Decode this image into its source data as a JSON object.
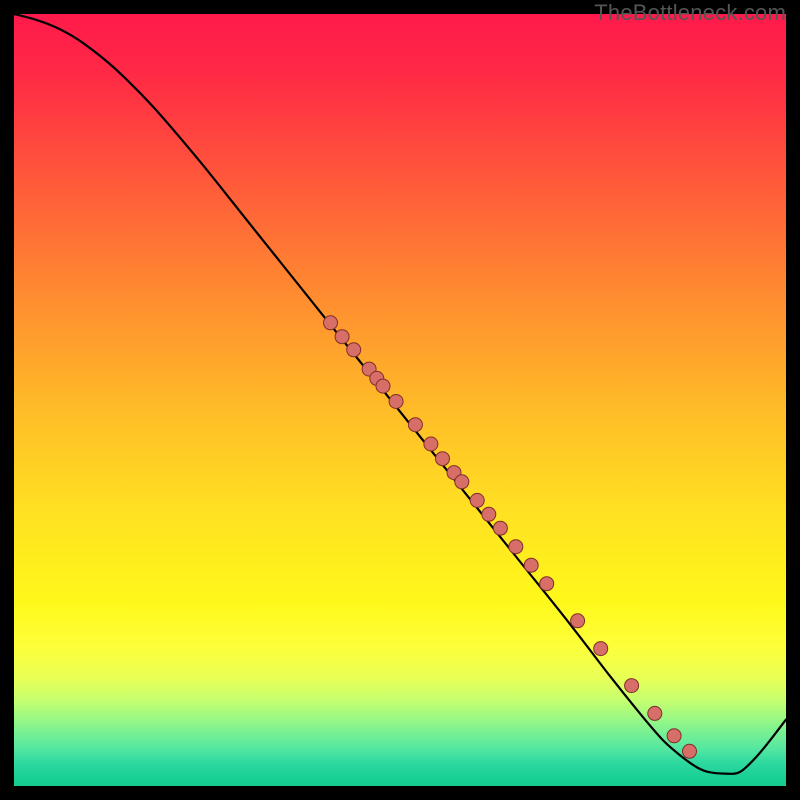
{
  "watermark": "TheBottleneck.com",
  "colors": {
    "curve": "#000000",
    "point_fill": "#d86e68",
    "point_stroke": "#7e2f2b"
  },
  "chart_data": {
    "type": "line",
    "title": "",
    "xlabel": "",
    "ylabel": "",
    "xlim": [
      0,
      100
    ],
    "ylim": [
      0,
      100
    ],
    "grid": false,
    "series": [
      {
        "name": "curve",
        "x": [
          0,
          3,
          6,
          9,
          13,
          18,
          24,
          30,
          36,
          42,
          48,
          54,
          60,
          66,
          72,
          77,
          81,
          84,
          86.5,
          88.5,
          90,
          92,
          94,
          96,
          98,
          100
        ],
        "y": [
          100,
          99.2,
          98.0,
          96.2,
          93.0,
          88.0,
          81.0,
          73.5,
          66.0,
          58.5,
          51.0,
          43.5,
          36.0,
          28.5,
          21.0,
          14.5,
          9.5,
          6.0,
          3.8,
          2.4,
          1.8,
          1.6,
          1.8,
          3.6,
          6.0,
          8.6
        ]
      }
    ],
    "scatter_points": {
      "name": "markers",
      "x": [
        41,
        42.5,
        44,
        46,
        47,
        47.8,
        49.5,
        52,
        54,
        55.5,
        57,
        58,
        60,
        61.5,
        63,
        65,
        67,
        69,
        73,
        76,
        80,
        83,
        85.5,
        87.5
      ],
      "y": [
        60,
        58.2,
        56.5,
        54.0,
        52.8,
        51.8,
        49.8,
        46.8,
        44.3,
        42.4,
        40.6,
        39.4,
        37.0,
        35.2,
        33.4,
        31.0,
        28.6,
        26.2,
        21.4,
        17.8,
        13.0,
        9.4,
        6.5,
        4.5
      ]
    }
  }
}
